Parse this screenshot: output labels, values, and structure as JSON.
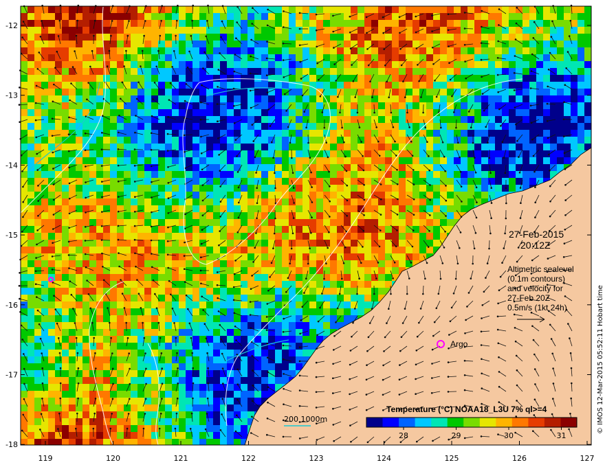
{
  "map": {
    "x_ticks": [
      "119",
      "120",
      "121",
      "122",
      "123",
      "124",
      "125",
      "126",
      "127"
    ],
    "y_ticks": [
      "-12",
      "-13",
      "-14",
      "-15",
      "-16",
      "-17",
      "-18"
    ]
  },
  "annotations": {
    "date": "27-Feb-2015",
    "time": "20:12Z",
    "altimetry_lines": [
      "Altimetric sealevel",
      "(0.1m contours)",
      "and velocity for",
      "27-Feb 20Z",
      "0.5m/s (1kt 24h)"
    ],
    "argo_label": "Argo",
    "depth_legend": "200  1000m"
  },
  "colorbar": {
    "title": "Temperature (°C) NOAA18_L3U 7% ql>=4",
    "ticks": [
      "28",
      "29",
      "30",
      "31"
    ],
    "colors": [
      "#00008b",
      "#0000ff",
      "#0064ff",
      "#00c8ff",
      "#00e6b4",
      "#00c800",
      "#78dc00",
      "#e6e600",
      "#ffb400",
      "#ff7800",
      "#e63c00",
      "#b41e00",
      "#8b0000"
    ]
  },
  "credit": "© IMOS 12-Mar-2015 05:52:11 Hobart time",
  "land_color": "#f5c8a0"
}
